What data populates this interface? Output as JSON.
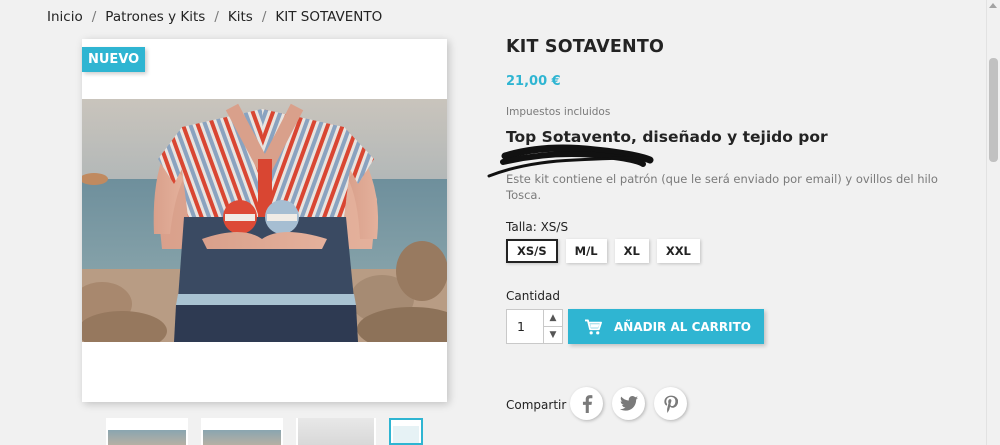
{
  "breadcrumb": {
    "items": [
      "Inicio",
      "Patrones y Kits",
      "Kits",
      "KIT SOTAVENTO"
    ],
    "separator": "/"
  },
  "product": {
    "badge": "NUEVO",
    "title": "KIT SOTAVENTO",
    "price": "21,00 €",
    "tax_note": "Impuestos incluidos",
    "subtitle": "Top Sotavento, diseñado y tejido por",
    "description": "Este kit contiene el patrón (que le será enviado por email) y ovillos del hilo Tosca."
  },
  "variants": {
    "label": "Talla: XS/S",
    "sizes": [
      "XS/S",
      "M/L",
      "XL",
      "XXL"
    ],
    "selected": "XS/S"
  },
  "quantity": {
    "label": "Cantidad",
    "value": "1"
  },
  "cart": {
    "button_label": "AÑADIR AL CARRITO"
  },
  "share": {
    "label": "Compartir",
    "networks": [
      "facebook-icon",
      "twitter-icon",
      "pinterest-icon"
    ]
  },
  "colors": {
    "accent": "#2fb5d2",
    "text": "#232323",
    "muted": "#7a7a7a",
    "background": "#f1f1f1"
  }
}
